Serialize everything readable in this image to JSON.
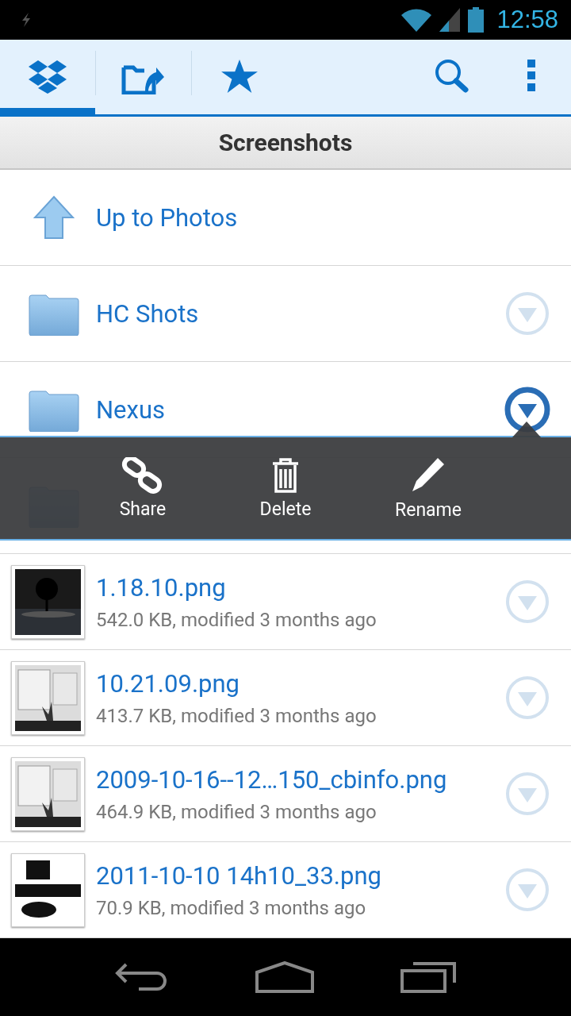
{
  "status_bar": {
    "time": "12:58"
  },
  "tabs": [
    {
      "selected": true
    },
    {
      "selected": false
    },
    {
      "selected": false
    }
  ],
  "breadcrumb": "Screenshots",
  "items": [
    {
      "kind": "up",
      "name": "Up to Photos"
    },
    {
      "kind": "folder",
      "name": "HC Shots",
      "menu_open": false
    },
    {
      "kind": "folder",
      "name": "Nexus",
      "menu_open": true
    },
    {
      "kind": "folder"
    },
    {
      "kind": "file",
      "name": "1.18.10.png",
      "meta": "542.0 KB, modified 3 months ago",
      "menu_open": false
    },
    {
      "kind": "file",
      "name": "10.21.09.png",
      "meta": "413.7 KB, modified 3 months ago",
      "menu_open": false
    },
    {
      "kind": "file",
      "name": "2009-10-16--12…150_cbinfo.png",
      "meta": "464.9 KB, modified 3 months ago",
      "menu_open": false
    },
    {
      "kind": "file",
      "name": "2011-10-10 14h10_33.png",
      "meta": "70.9 KB, modified 3 months ago",
      "menu_open": false
    }
  ],
  "popup": {
    "actions": [
      {
        "kind": "share",
        "label": "Share"
      },
      {
        "kind": "delete",
        "label": "Delete"
      },
      {
        "kind": "rename",
        "label": "Rename"
      }
    ]
  }
}
